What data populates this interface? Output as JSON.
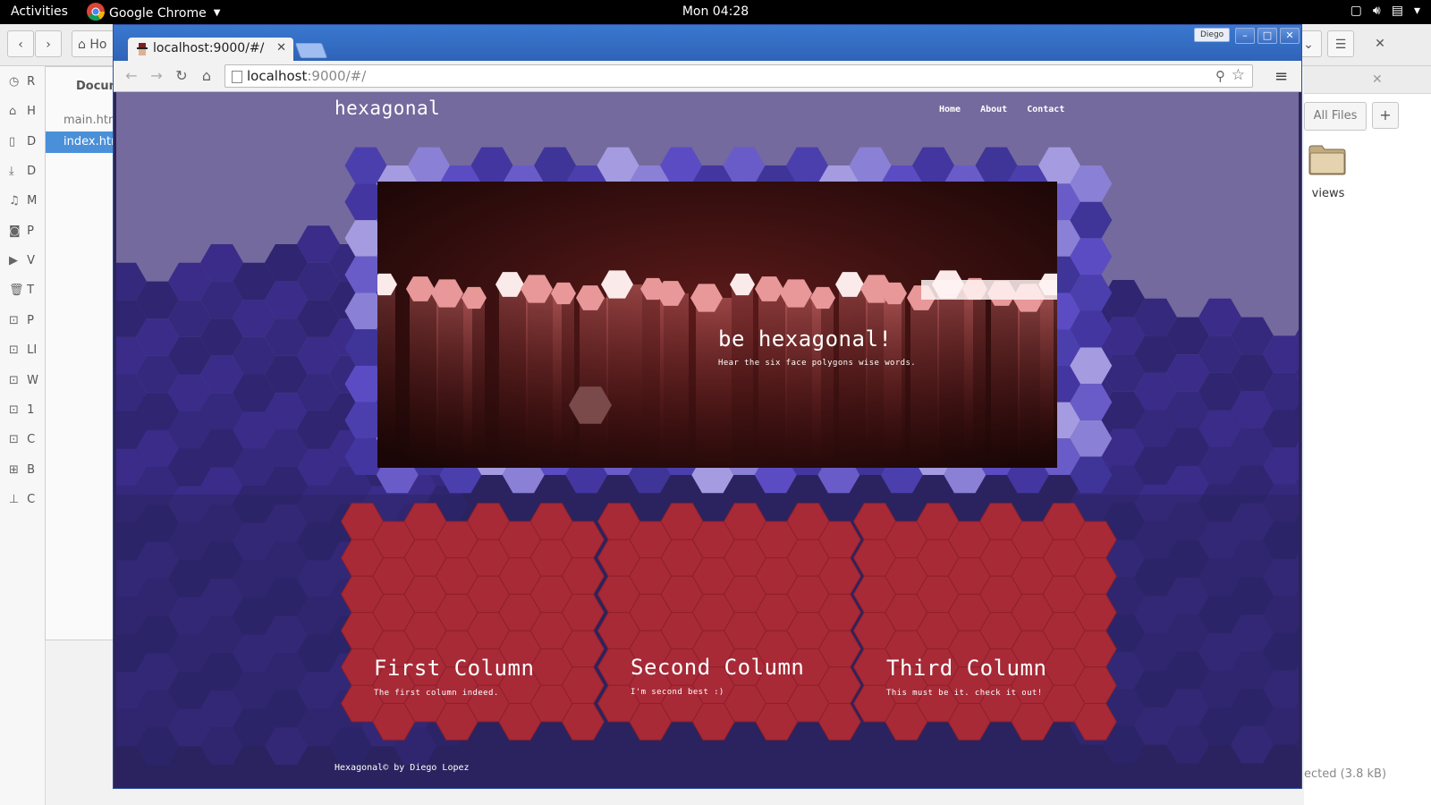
{
  "topbar": {
    "activities": "Activities",
    "app_name": "Google Chrome",
    "clock": "Mon 04:28"
  },
  "nautilus": {
    "sidebar_items": [
      "R",
      "H",
      "D",
      "D",
      "M",
      "P",
      "V",
      "T",
      "P",
      "LI",
      "W",
      "1",
      "C",
      "B",
      "C"
    ],
    "location": "Ho",
    "inner_header": "Docun",
    "files": [
      "main.htm",
      "index.htm"
    ],
    "filter": "All Files",
    "folder_name": "views",
    "status": "ected (3.8 kB)"
  },
  "browser": {
    "tab_title": "localhost:9000/#/",
    "url_host": "localhost",
    "url_rest": ":9000/#/",
    "profile": "Diego",
    "minimize": "–",
    "maximize": "□",
    "close": "✕"
  },
  "site": {
    "title": "hexagonal",
    "nav": [
      "Home",
      "About",
      "Contact"
    ],
    "hero_title": "be hexagonal!",
    "hero_subtitle": "Hear the six face polygons wise words.",
    "columns": [
      {
        "title": "First Column",
        "text": "The first column indeed."
      },
      {
        "title": "Second Column",
        "text": "I'm second best :)"
      },
      {
        "title": "Third Column",
        "text": "This must be it. check it out!"
      }
    ],
    "footer_prefix": "Hexagonal",
    "footer_suffix": " by Diego Lopez"
  },
  "colors": {
    "page_bg": "#2b2360",
    "hex_light": "#746a9d",
    "hex_violet": "#4a3ea6",
    "column_red": "#a82a37",
    "chrome_blue": "#3a78d0"
  }
}
